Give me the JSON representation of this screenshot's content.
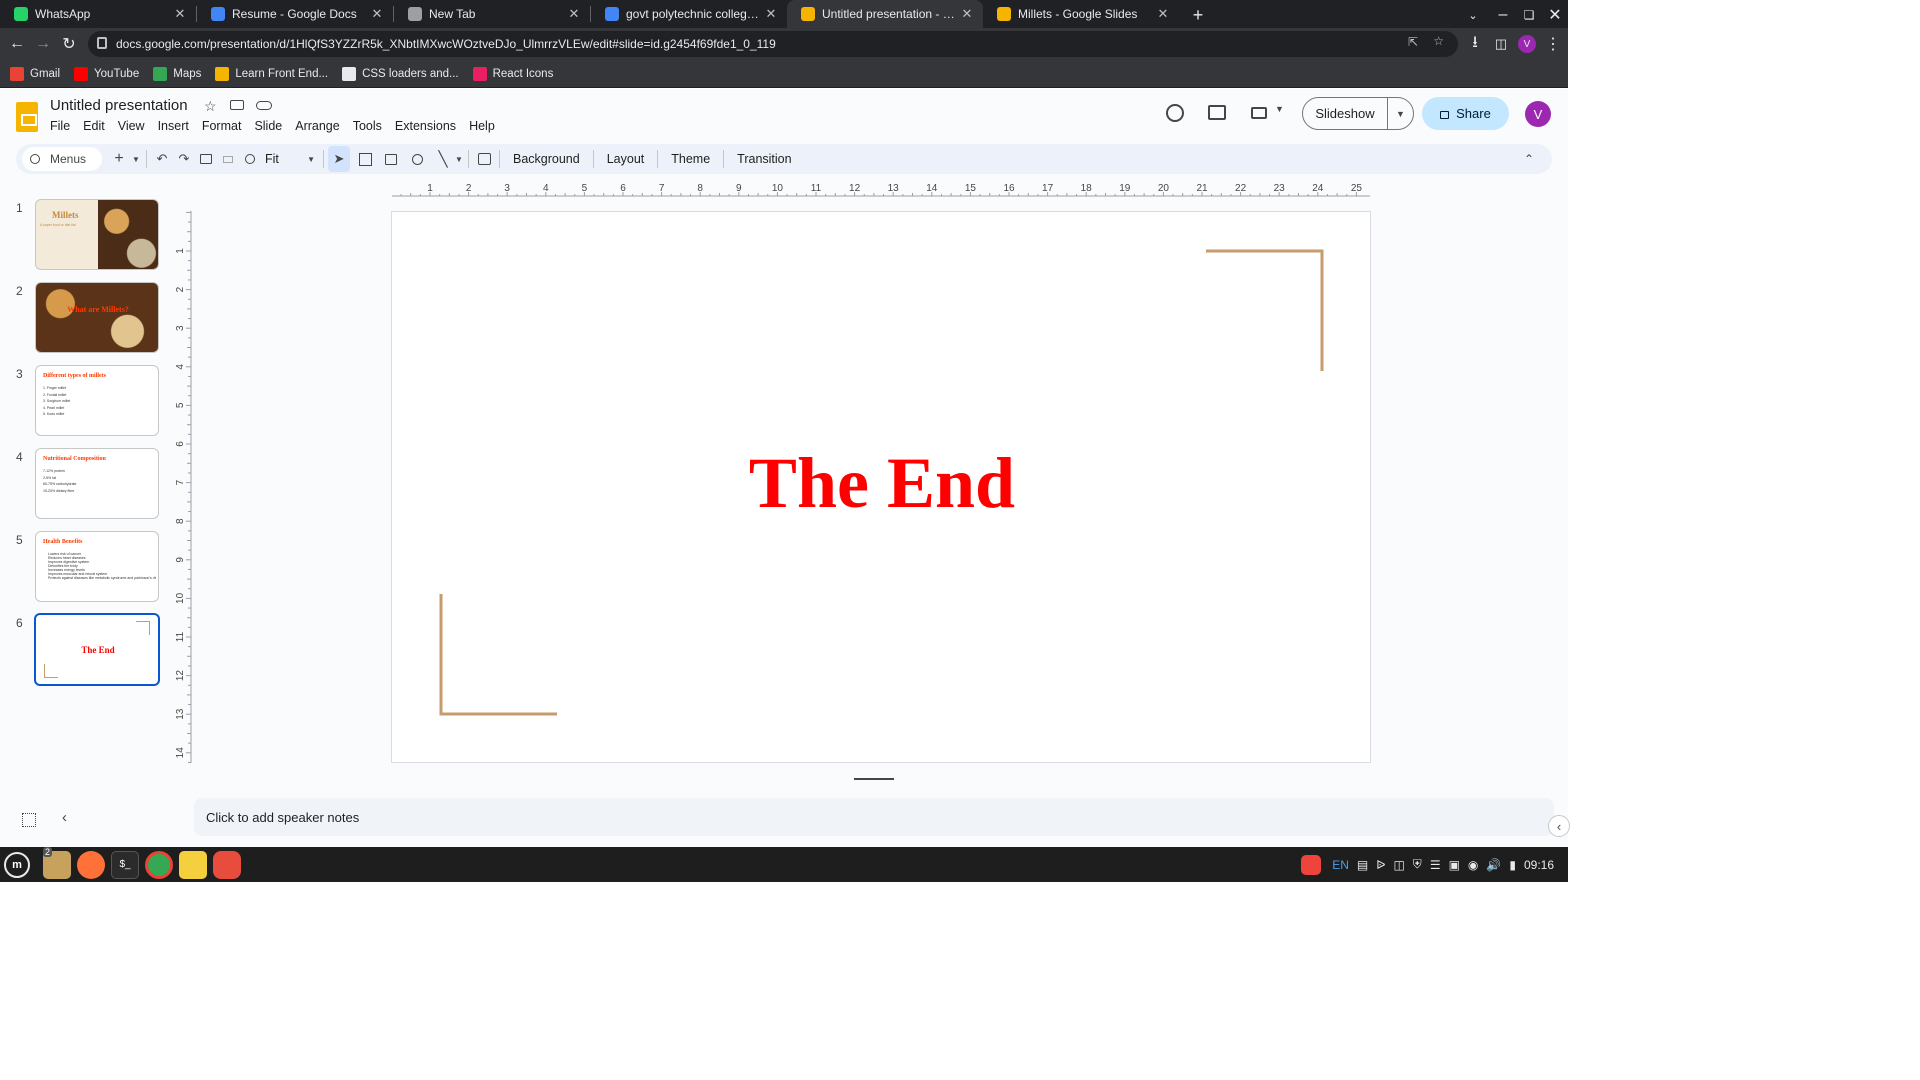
{
  "browser": {
    "tabs": [
      {
        "title": "WhatsApp",
        "icon": "whatsapp-icon",
        "color": "#25d366"
      },
      {
        "title": "Resume - Google Docs",
        "icon": "google-docs-icon",
        "color": "#4285f4"
      },
      {
        "title": "New Tab",
        "icon": "chrome-icon",
        "color": "#9aa0a6"
      },
      {
        "title": "govt polytechnic college peru",
        "icon": "google-icon",
        "color": "#4285f4"
      },
      {
        "title": "Untitled presentation - Googl",
        "icon": "google-slides-icon",
        "color": "#f4b400"
      },
      {
        "title": "Millets - Google Slides",
        "icon": "google-slides-icon",
        "color": "#f4b400"
      }
    ],
    "active_tab": 4,
    "url": "docs.google.com/presentation/d/1HlQfS3YZZrR5k_XNbtIMXwcWOztveDJo_UlmrrzVLEw/edit#slide=id.g2454f69fde1_0_119",
    "profile_initial": "V",
    "bookmarks": [
      {
        "label": "Gmail",
        "icon": "gmail-icon",
        "color": "#ea4335"
      },
      {
        "label": "YouTube",
        "icon": "youtube-icon",
        "color": "#ff0000"
      },
      {
        "label": "Maps",
        "icon": "maps-icon",
        "color": "#34a853"
      },
      {
        "label": "Learn Front End...",
        "icon": "bookmark-icon",
        "color": "#f4b400"
      },
      {
        "label": "CSS loaders and...",
        "icon": "loader-icon",
        "color": "#e8eaed"
      },
      {
        "label": "React Icons",
        "icon": "react-icon",
        "color": "#e91e63"
      }
    ]
  },
  "doc": {
    "title": "Untitled presentation",
    "menus": [
      "File",
      "Edit",
      "View",
      "Insert",
      "Format",
      "Slide",
      "Arrange",
      "Tools",
      "Extensions",
      "Help"
    ],
    "slideshow_label": "Slideshow",
    "share_label": "Share",
    "avatar_initial": "V"
  },
  "toolbar": {
    "menus_label": "Menus",
    "zoom_label": "Fit",
    "background_label": "Background",
    "layout_label": "Layout",
    "theme_label": "Theme",
    "transition_label": "Transition"
  },
  "slides": [
    {
      "number": "1",
      "title": "Millets",
      "subtitle": "A super food or diet list"
    },
    {
      "number": "2",
      "title": "What are Millets?"
    },
    {
      "number": "3",
      "title": "Different types of millets",
      "lines": [
        "1. Finger millet",
        "2. Foxtail millet",
        "3. Sorghum millet",
        "4. Pearl millet",
        "5. Kodo millet"
      ]
    },
    {
      "number": "4",
      "title": "Nutritional Composition",
      "lines": [
        "7-12% protein",
        "2-5% fat",
        "65-75% carbohydrate",
        "15-20% dietary fibre"
      ]
    },
    {
      "number": "5",
      "title": "Health Benefits",
      "lines": [
        "Lowers risk of cancer",
        "Reduces heart diseases",
        "Improves digestive system",
        "Detoxifies the body",
        "Increases energy levels",
        "Improves muscular and neural system",
        "Protects against diseases like metabolic syndrome and parkinson's disease"
      ]
    },
    {
      "number": "6",
      "title": "The End"
    }
  ],
  "selected_slide": 5,
  "ruler": {
    "horizontal": [
      "1",
      "2",
      "3",
      "4",
      "5",
      "6",
      "7",
      "8",
      "9",
      "10",
      "11",
      "12",
      "13",
      "14",
      "15",
      "16",
      "17",
      "18",
      "19",
      "20",
      "21",
      "22",
      "23",
      "24",
      "25"
    ],
    "vertical": [
      "1",
      "2",
      "3",
      "4",
      "5",
      "6",
      "7",
      "8",
      "9",
      "10",
      "11",
      "12",
      "13",
      "14"
    ]
  },
  "canvas": {
    "title_text": "The End",
    "title_color": "#ff0000",
    "accent_color": "#c69c6d"
  },
  "notes_placeholder": "Click to add speaker notes",
  "taskbar": {
    "language": "EN",
    "clock": "09:16",
    "files_badge": "2"
  }
}
